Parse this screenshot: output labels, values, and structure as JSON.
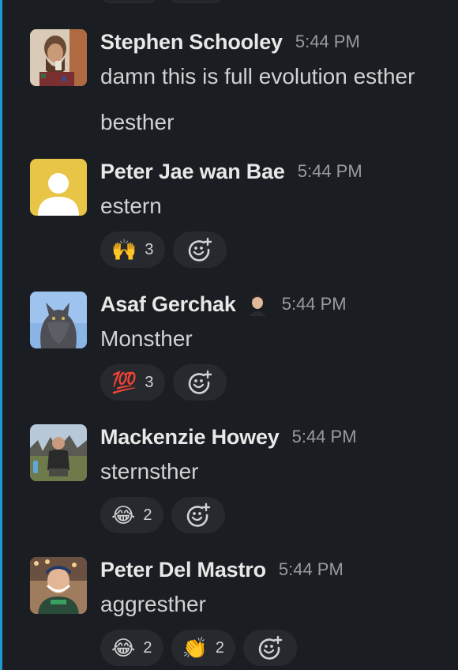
{
  "messages": [
    {
      "name": "Stephen Schooley",
      "time": "5:44 PM",
      "lines": [
        "damn this is full evolution esther",
        "besther"
      ],
      "reactions": []
    },
    {
      "name": "Peter Jae wan Bae",
      "time": "5:44 PM",
      "lines": [
        "estern"
      ],
      "reactions": [
        {
          "emoji": "🙌",
          "count": "3"
        }
      ]
    },
    {
      "name": "Asaf Gerchak",
      "time": "5:44 PM",
      "lines": [
        "Monsther"
      ],
      "reactions": [
        {
          "emoji": "💯",
          "count": "3"
        }
      ]
    },
    {
      "name": "Mackenzie Howey",
      "time": "5:44 PM",
      "lines": [
        "sternsther"
      ],
      "reactions": [
        {
          "emoji": "😂",
          "count": "2"
        }
      ]
    },
    {
      "name": "Peter Del Mastro",
      "time": "5:44 PM",
      "lines": [
        "aggresther"
      ],
      "reactions": [
        {
          "emoji": "😂",
          "count": "2"
        },
        {
          "emoji": "👏",
          "count": "2"
        }
      ]
    }
  ],
  "icons": {
    "add_reaction": "add-reaction-icon",
    "default_avatar": "default-user-avatar-icon"
  },
  "colors": {
    "background": "#1a1d21",
    "reaction_bg": "#26292d",
    "default_avatar_bg": "#e8c547",
    "rail": "#1d9bd1"
  }
}
